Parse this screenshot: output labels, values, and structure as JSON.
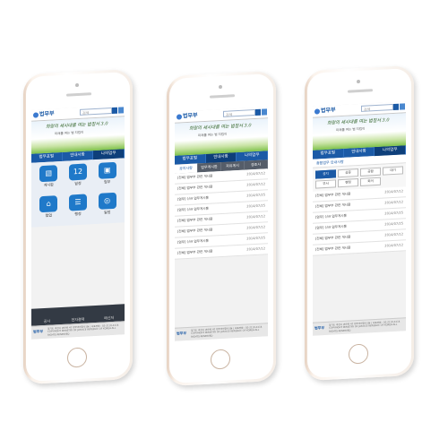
{
  "header": {
    "logo": "법무부",
    "search_placeholder": "검색",
    "banner_line1": "희망의 새시대를 여는 법질서 3.0",
    "banner_line2": "미래를 여는 법 지킴이"
  },
  "tabs": [
    {
      "label": "법무포털"
    },
    {
      "label": "안내사항"
    },
    {
      "label": "나의업무"
    }
  ],
  "phone1": {
    "tiles": [
      {
        "label": "게시판",
        "icon": "▤"
      },
      {
        "label": "일정",
        "icon": "12"
      },
      {
        "label": "업무",
        "icon": "▣"
      },
      {
        "label": "협업",
        "icon": "⌂"
      },
      {
        "label": "행정",
        "icon": "☰"
      },
      {
        "label": "일정",
        "icon": "◎"
      }
    ],
    "footer_buttons": [
      {
        "label": "공사"
      },
      {
        "label": "전자결재"
      },
      {
        "label": "메신저"
      }
    ]
  },
  "phone2": {
    "subtabs": [
      {
        "label": "공지사항"
      },
      {
        "label": "업무게시판"
      },
      {
        "label": "자유게시"
      },
      {
        "label": "경조사"
      }
    ],
    "rows": [
      {
        "title": "[전체] 법무부 관련 게시물",
        "date": "2014/07/12"
      },
      {
        "title": "[전체] 법무부 관련 게시물",
        "date": "2014/07/12"
      },
      {
        "title": "[업무] 신규 업무게시물",
        "date": "2014/07/25"
      },
      {
        "title": "[업무] 신규 업무게시물",
        "date": "2014/07/25"
      },
      {
        "title": "[전체] 법무부 관련 게시물",
        "date": "2014/07/12"
      },
      {
        "title": "[전체] 법무부 관련 게시물",
        "date": "2014/07/12"
      },
      {
        "title": "[업무] 신규 업무게시물",
        "date": "2014/07/25"
      },
      {
        "title": "[전체] 법무부 관련 게시물",
        "date": "2014/07/12"
      }
    ]
  },
  "phone3": {
    "section_title": "종합업무 안내사항",
    "cats": [
      {
        "label": "공지"
      },
      {
        "label": "공문"
      },
      {
        "label": "공람"
      },
      {
        "label": "대기"
      },
      {
        "label": "부서"
      },
      {
        "label": "행정"
      },
      {
        "label": "회의"
      }
    ],
    "rows": [
      {
        "title": "[전체] 법무부 관련 게시물",
        "date": "2014/07/12"
      },
      {
        "title": "[전체] 법무부 관련 게시물",
        "date": "2014/07/12"
      },
      {
        "title": "[업무] 신규 업무게시물",
        "date": "2014/07/25"
      },
      {
        "title": "[업무] 신규 업무게시물",
        "date": "2014/07/25"
      },
      {
        "title": "[전체] 법무부 관련 게시물",
        "date": "2014/07/12"
      },
      {
        "title": "[전체] 법무부 관련 게시물",
        "date": "2014/07/12"
      }
    ]
  },
  "footer": {
    "logo": "법무부",
    "text": "경기도 과천시 관문로 47 정부과천청사1동 | 대표전화 : 02-2110-3114 COPYRIGHT MINISTRY OF JUSTICE REPUBLIC OF KOREA ALL RIGHTS RESERVED"
  }
}
